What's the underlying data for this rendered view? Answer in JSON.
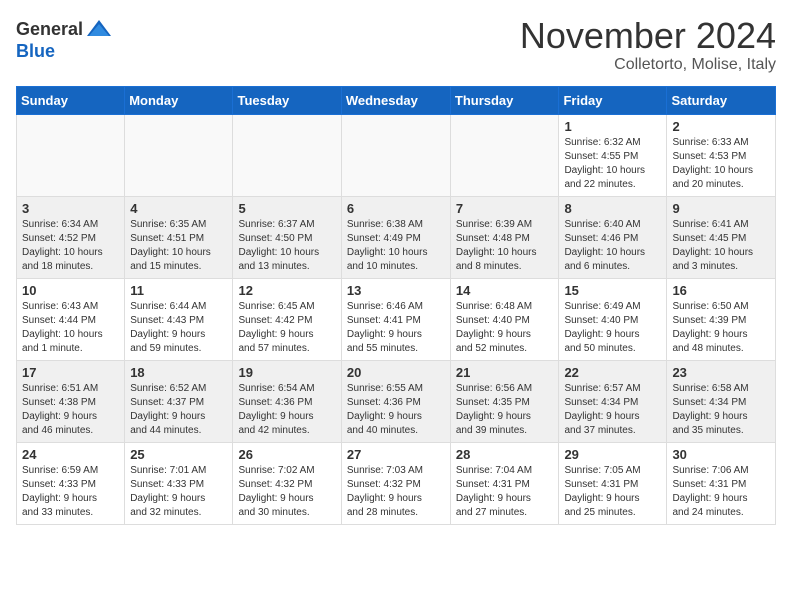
{
  "header": {
    "logo_general": "General",
    "logo_blue": "Blue",
    "month_title": "November 2024",
    "location": "Colletorto, Molise, Italy"
  },
  "weekdays": [
    "Sunday",
    "Monday",
    "Tuesday",
    "Wednesday",
    "Thursday",
    "Friday",
    "Saturday"
  ],
  "weeks": [
    [
      {
        "day": "",
        "info": ""
      },
      {
        "day": "",
        "info": ""
      },
      {
        "day": "",
        "info": ""
      },
      {
        "day": "",
        "info": ""
      },
      {
        "day": "",
        "info": ""
      },
      {
        "day": "1",
        "info": "Sunrise: 6:32 AM\nSunset: 4:55 PM\nDaylight: 10 hours\nand 22 minutes."
      },
      {
        "day": "2",
        "info": "Sunrise: 6:33 AM\nSunset: 4:53 PM\nDaylight: 10 hours\nand 20 minutes."
      }
    ],
    [
      {
        "day": "3",
        "info": "Sunrise: 6:34 AM\nSunset: 4:52 PM\nDaylight: 10 hours\nand 18 minutes."
      },
      {
        "day": "4",
        "info": "Sunrise: 6:35 AM\nSunset: 4:51 PM\nDaylight: 10 hours\nand 15 minutes."
      },
      {
        "day": "5",
        "info": "Sunrise: 6:37 AM\nSunset: 4:50 PM\nDaylight: 10 hours\nand 13 minutes."
      },
      {
        "day": "6",
        "info": "Sunrise: 6:38 AM\nSunset: 4:49 PM\nDaylight: 10 hours\nand 10 minutes."
      },
      {
        "day": "7",
        "info": "Sunrise: 6:39 AM\nSunset: 4:48 PM\nDaylight: 10 hours\nand 8 minutes."
      },
      {
        "day": "8",
        "info": "Sunrise: 6:40 AM\nSunset: 4:46 PM\nDaylight: 10 hours\nand 6 minutes."
      },
      {
        "day": "9",
        "info": "Sunrise: 6:41 AM\nSunset: 4:45 PM\nDaylight: 10 hours\nand 3 minutes."
      }
    ],
    [
      {
        "day": "10",
        "info": "Sunrise: 6:43 AM\nSunset: 4:44 PM\nDaylight: 10 hours\nand 1 minute."
      },
      {
        "day": "11",
        "info": "Sunrise: 6:44 AM\nSunset: 4:43 PM\nDaylight: 9 hours\nand 59 minutes."
      },
      {
        "day": "12",
        "info": "Sunrise: 6:45 AM\nSunset: 4:42 PM\nDaylight: 9 hours\nand 57 minutes."
      },
      {
        "day": "13",
        "info": "Sunrise: 6:46 AM\nSunset: 4:41 PM\nDaylight: 9 hours\nand 55 minutes."
      },
      {
        "day": "14",
        "info": "Sunrise: 6:48 AM\nSunset: 4:40 PM\nDaylight: 9 hours\nand 52 minutes."
      },
      {
        "day": "15",
        "info": "Sunrise: 6:49 AM\nSunset: 4:40 PM\nDaylight: 9 hours\nand 50 minutes."
      },
      {
        "day": "16",
        "info": "Sunrise: 6:50 AM\nSunset: 4:39 PM\nDaylight: 9 hours\nand 48 minutes."
      }
    ],
    [
      {
        "day": "17",
        "info": "Sunrise: 6:51 AM\nSunset: 4:38 PM\nDaylight: 9 hours\nand 46 minutes."
      },
      {
        "day": "18",
        "info": "Sunrise: 6:52 AM\nSunset: 4:37 PM\nDaylight: 9 hours\nand 44 minutes."
      },
      {
        "day": "19",
        "info": "Sunrise: 6:54 AM\nSunset: 4:36 PM\nDaylight: 9 hours\nand 42 minutes."
      },
      {
        "day": "20",
        "info": "Sunrise: 6:55 AM\nSunset: 4:36 PM\nDaylight: 9 hours\nand 40 minutes."
      },
      {
        "day": "21",
        "info": "Sunrise: 6:56 AM\nSunset: 4:35 PM\nDaylight: 9 hours\nand 39 minutes."
      },
      {
        "day": "22",
        "info": "Sunrise: 6:57 AM\nSunset: 4:34 PM\nDaylight: 9 hours\nand 37 minutes."
      },
      {
        "day": "23",
        "info": "Sunrise: 6:58 AM\nSunset: 4:34 PM\nDaylight: 9 hours\nand 35 minutes."
      }
    ],
    [
      {
        "day": "24",
        "info": "Sunrise: 6:59 AM\nSunset: 4:33 PM\nDaylight: 9 hours\nand 33 minutes."
      },
      {
        "day": "25",
        "info": "Sunrise: 7:01 AM\nSunset: 4:33 PM\nDaylight: 9 hours\nand 32 minutes."
      },
      {
        "day": "26",
        "info": "Sunrise: 7:02 AM\nSunset: 4:32 PM\nDaylight: 9 hours\nand 30 minutes."
      },
      {
        "day": "27",
        "info": "Sunrise: 7:03 AM\nSunset: 4:32 PM\nDaylight: 9 hours\nand 28 minutes."
      },
      {
        "day": "28",
        "info": "Sunrise: 7:04 AM\nSunset: 4:31 PM\nDaylight: 9 hours\nand 27 minutes."
      },
      {
        "day": "29",
        "info": "Sunrise: 7:05 AM\nSunset: 4:31 PM\nDaylight: 9 hours\nand 25 minutes."
      },
      {
        "day": "30",
        "info": "Sunrise: 7:06 AM\nSunset: 4:31 PM\nDaylight: 9 hours\nand 24 minutes."
      }
    ]
  ]
}
